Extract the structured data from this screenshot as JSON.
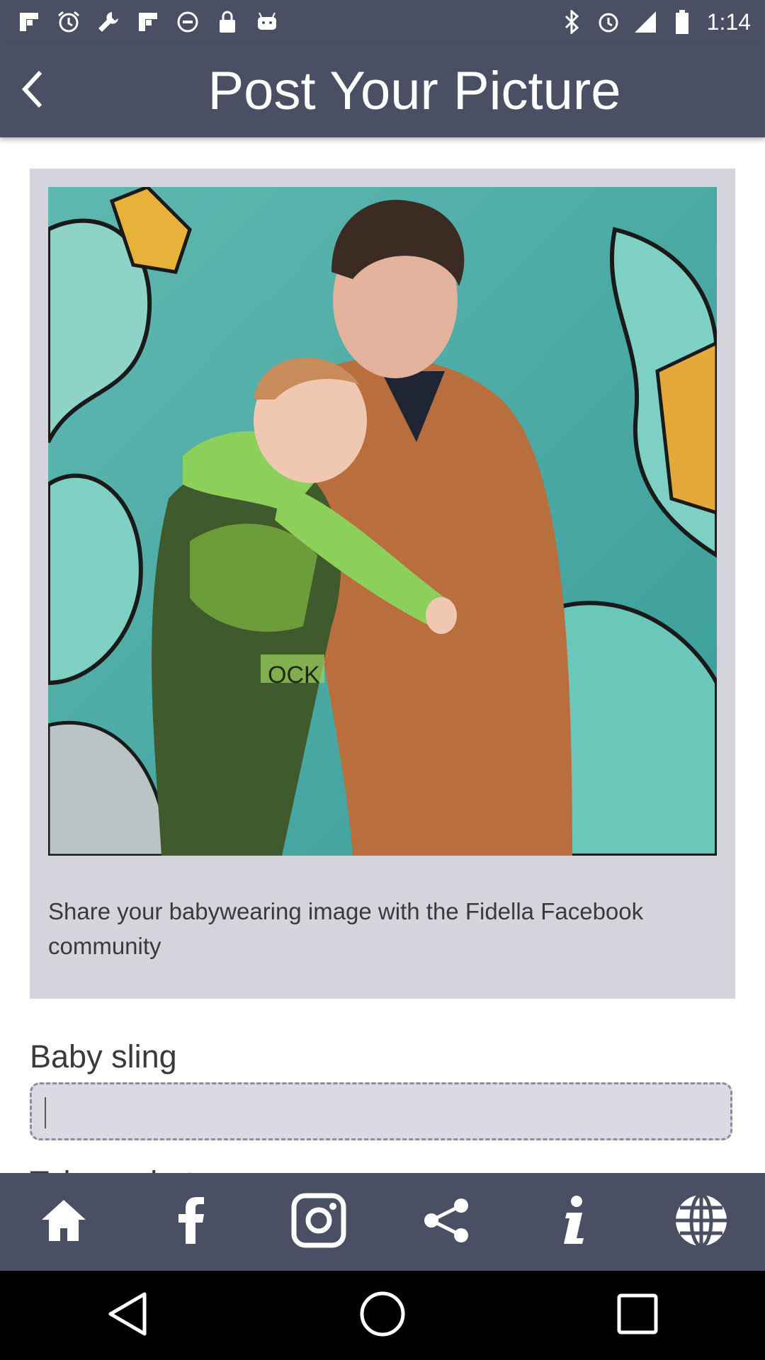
{
  "status_bar": {
    "time": "1:14",
    "left_icons": [
      "flipboard-icon",
      "alarm-icon",
      "wrench-icon",
      "flipboard-icon",
      "blocked-icon",
      "lock-icon",
      "android-icon"
    ],
    "right_icons": [
      "bluetooth-icon",
      "alarm-icon",
      "signal-icon",
      "battery-icon"
    ]
  },
  "header": {
    "title": "Post Your Picture",
    "back_icon": "chevron-left-icon"
  },
  "card": {
    "caption": "Share your babywearing image with the Fidella Facebook community"
  },
  "form": {
    "baby_sling_label": "Baby sling",
    "baby_sling_value": "",
    "next_label_partial": "Take a photo"
  },
  "bottom_nav": {
    "items": [
      "home-icon",
      "facebook-icon",
      "instagram-icon",
      "share-icon",
      "info-icon",
      "globe-icon"
    ]
  },
  "colors": {
    "bar": "#4a4f63",
    "card": "#d4d4dc",
    "text": "#3a3a3a"
  }
}
